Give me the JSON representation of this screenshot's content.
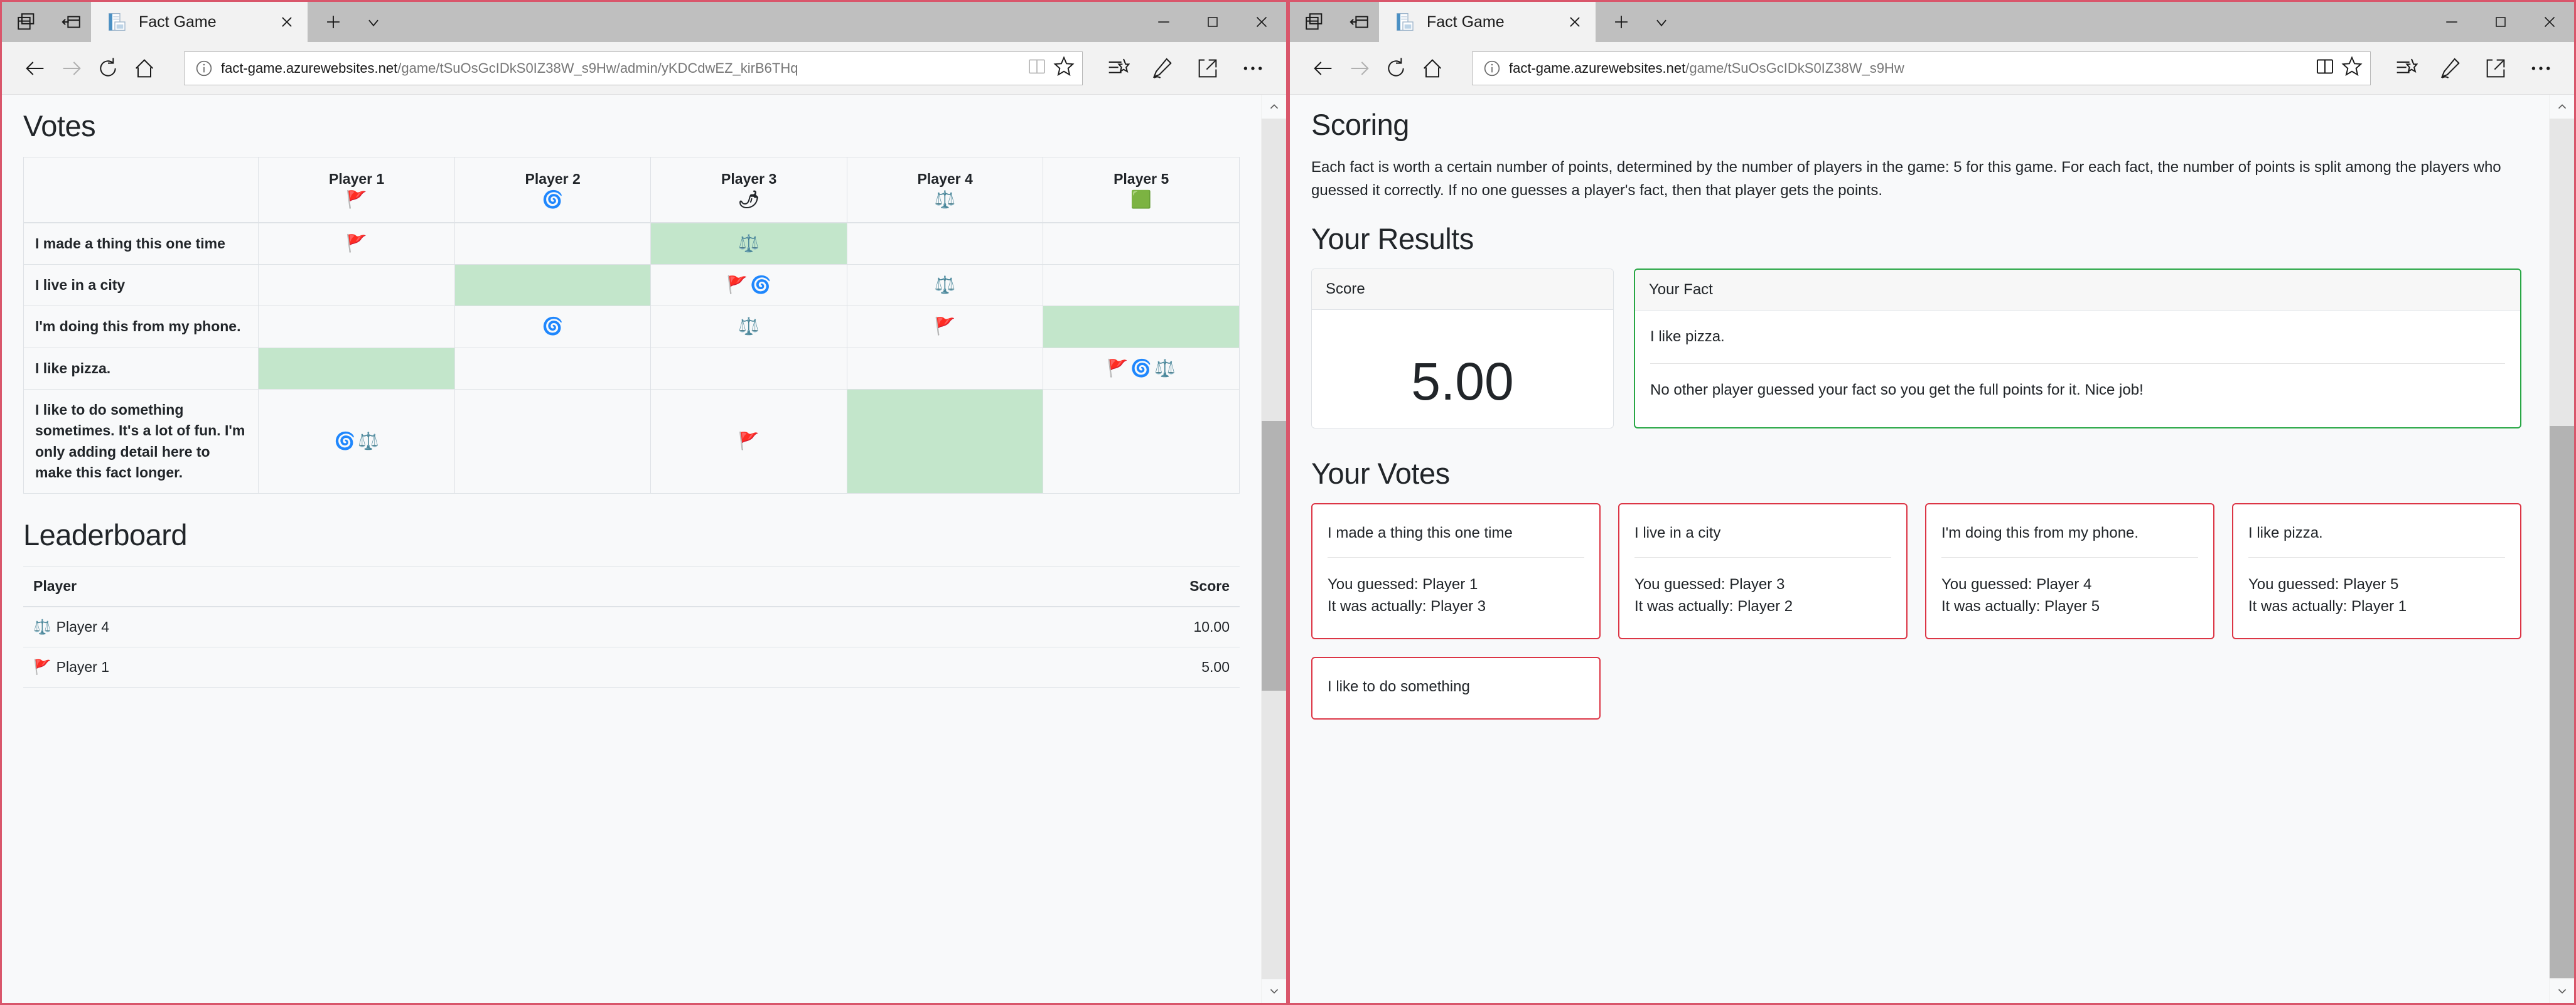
{
  "left_window": {
    "tab": {
      "title": "Fact Game",
      "favicon": "page-favicon-icon"
    },
    "url": {
      "host": "fact-game.azurewebsites.net",
      "path": "/game/tSuOsGcIDkS0IZ38W_s9Hw/admin/yKDCdwEZ_kirB6THq"
    },
    "toolbar": {
      "back": "back-arrow-icon",
      "forward": "forward-arrow-icon",
      "refresh": "refresh-icon",
      "home": "home-icon",
      "reading_view": "reading-view-icon",
      "favorite": "star-icon",
      "favorites_hub": "favorites-hub-icon",
      "web_notes": "pen-icon",
      "share": "share-icon",
      "more": "more-icon"
    },
    "page": {
      "votes_heading": "Votes",
      "players": [
        {
          "name": "Player 1",
          "emoji": "🚩"
        },
        {
          "name": "Player 2",
          "emoji": "🌀"
        },
        {
          "name": "Player 3",
          "emoji": "🌶"
        },
        {
          "name": "Player 4",
          "emoji": "⚖️"
        },
        {
          "name": "Player 5",
          "emoji": "🟩"
        }
      ],
      "votes_rows": [
        {
          "fact": "I made a thing this one time",
          "cells": [
            {
              "icons": [
                "🚩"
              ],
              "correct": false
            },
            {
              "icons": [],
              "correct": false
            },
            {
              "icons": [
                "⚖️"
              ],
              "correct": true
            },
            {
              "icons": [],
              "correct": false
            },
            {
              "icons": [],
              "correct": false
            }
          ]
        },
        {
          "fact": "I live in a city",
          "cells": [
            {
              "icons": [],
              "correct": false
            },
            {
              "icons": [],
              "correct": true
            },
            {
              "icons": [
                "🚩",
                "🌀"
              ],
              "correct": false
            },
            {
              "icons": [
                "⚖️"
              ],
              "correct": false
            },
            {
              "icons": [],
              "correct": false
            }
          ]
        },
        {
          "fact": "I'm doing this from my phone.",
          "cells": [
            {
              "icons": [],
              "correct": false
            },
            {
              "icons": [
                "🌀"
              ],
              "correct": false
            },
            {
              "icons": [
                "⚖️"
              ],
              "correct": false
            },
            {
              "icons": [
                "🚩"
              ],
              "correct": false
            },
            {
              "icons": [],
              "correct": true
            }
          ]
        },
        {
          "fact": "I like pizza.",
          "cells": [
            {
              "icons": [],
              "correct": true
            },
            {
              "icons": [],
              "correct": false
            },
            {
              "icons": [],
              "correct": false
            },
            {
              "icons": [],
              "correct": false
            },
            {
              "icons": [
                "🚩",
                "🌀",
                "⚖️"
              ],
              "correct": false
            }
          ]
        },
        {
          "fact": "I like to do something sometimes. It's a lot of fun. I'm only adding detail here to make this fact longer.",
          "cells": [
            {
              "icons": [
                "🌀",
                "⚖️"
              ],
              "correct": false
            },
            {
              "icons": [],
              "correct": false
            },
            {
              "icons": [
                "🚩"
              ],
              "correct": false
            },
            {
              "icons": [],
              "correct": true
            },
            {
              "icons": [],
              "correct": false
            }
          ]
        }
      ],
      "leaderboard_heading": "Leaderboard",
      "leaderboard_columns": {
        "player": "Player",
        "score": "Score"
      },
      "leaderboard_rows": [
        {
          "emoji": "⚖️",
          "name": "Player 4",
          "score": "10.00"
        },
        {
          "emoji": "🚩",
          "name": "Player 1",
          "score": "5.00"
        }
      ]
    }
  },
  "right_window": {
    "tab": {
      "title": "Fact Game",
      "favicon": "page-favicon-icon"
    },
    "url": {
      "host": "fact-game.azurewebsites.net",
      "path": "/game/tSuOsGcIDkS0IZ38W_s9Hw"
    },
    "page": {
      "scoring_heading": "Scoring",
      "scoring_text": "Each fact is worth a certain number of points, determined by the number of players in the game: 5 for this game. For each fact, the number of points is split among the players who guessed it correctly. If no one guesses a player's fact, then that player gets the points.",
      "results_heading": "Your Results",
      "score_card": {
        "header": "Score",
        "value": "5.00"
      },
      "fact_card": {
        "header": "Your Fact",
        "fact": "I like pizza.",
        "note": "No other player guessed your fact so you get the full points for it. Nice job!"
      },
      "votes_heading": "Your Votes",
      "vote_cards": [
        {
          "fact": "I made a thing this one time",
          "guessed": "You guessed: Player 1",
          "actual": "It was actually: Player 3"
        },
        {
          "fact": "I live in a city",
          "guessed": "You guessed: Player 3",
          "actual": "It was actually: Player 2"
        },
        {
          "fact": "I'm doing this from my phone.",
          "guessed": "You guessed: Player 4",
          "actual": "It was actually: Player 5"
        },
        {
          "fact": "I like pizza.",
          "guessed": "You guessed: Player 5",
          "actual": "It was actually: Player 1"
        }
      ],
      "vote_card_partial": {
        "fact": "I like to do something"
      }
    }
  },
  "colors": {
    "accent_red": "#dc3545",
    "accent_green": "#28a745",
    "correct_bg": "#c3e6cb",
    "page_bg": "#f8f9fa",
    "window_border": "#d9566b"
  }
}
